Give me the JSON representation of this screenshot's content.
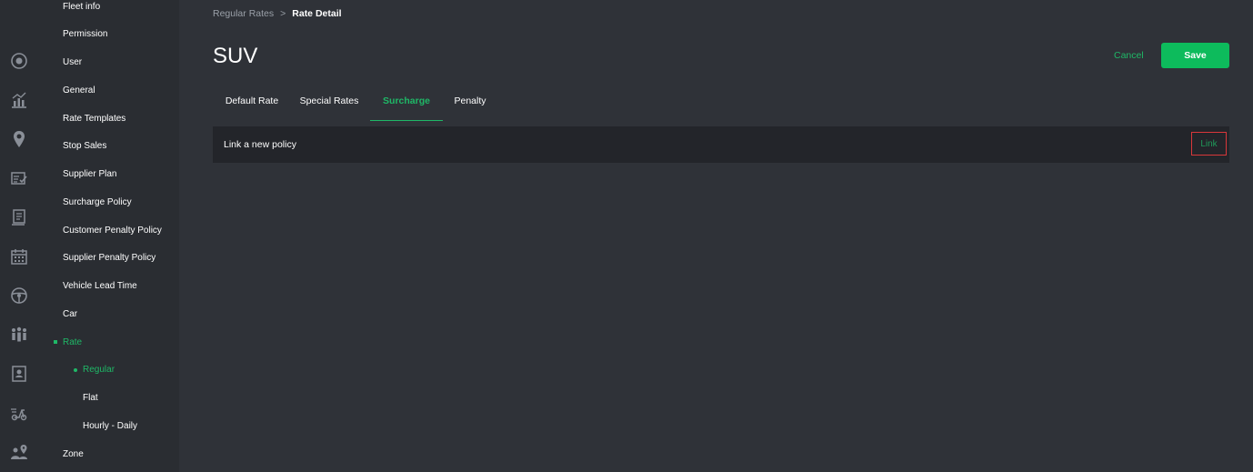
{
  "sidebar": {
    "rail_icons": [
      "target-icon",
      "chart-icon",
      "location-pin-icon",
      "checklist-icon",
      "document-icon",
      "calendar-icon",
      "steering-wheel-icon",
      "team-icon",
      "contact-card-icon",
      "scooter-icon",
      "group-pin-icon"
    ],
    "items": [
      {
        "label": "Fleet info"
      },
      {
        "label": "Permission"
      },
      {
        "label": "User"
      },
      {
        "label": "General"
      },
      {
        "label": "Rate Templates"
      },
      {
        "label": "Stop Sales"
      },
      {
        "label": "Supplier Plan"
      },
      {
        "label": "Surcharge Policy"
      },
      {
        "label": "Customer Penalty Policy"
      },
      {
        "label": "Supplier Penalty Policy"
      },
      {
        "label": "Vehicle Lead Time"
      },
      {
        "label": "Car"
      },
      {
        "label": "Rate"
      },
      {
        "label": "Regular"
      },
      {
        "label": "Flat"
      },
      {
        "label": "Hourly - Daily"
      },
      {
        "label": "Zone"
      }
    ]
  },
  "breadcrumb": {
    "parent": "Regular Rates",
    "separator": ">",
    "current": "Rate Detail"
  },
  "page": {
    "title": "SUV"
  },
  "actions": {
    "cancel_label": "Cancel",
    "save_label": "Save"
  },
  "tabs": [
    {
      "label": "Default Rate"
    },
    {
      "label": "Special Rates"
    },
    {
      "label": "Surcharge",
      "active": true
    },
    {
      "label": "Penalty"
    }
  ],
  "policy": {
    "label": "Link a new policy",
    "link_label": "Link"
  },
  "colors": {
    "accent": "#1fb867",
    "save_bg": "#0dbb5c",
    "highlight_border": "#d9373a"
  }
}
